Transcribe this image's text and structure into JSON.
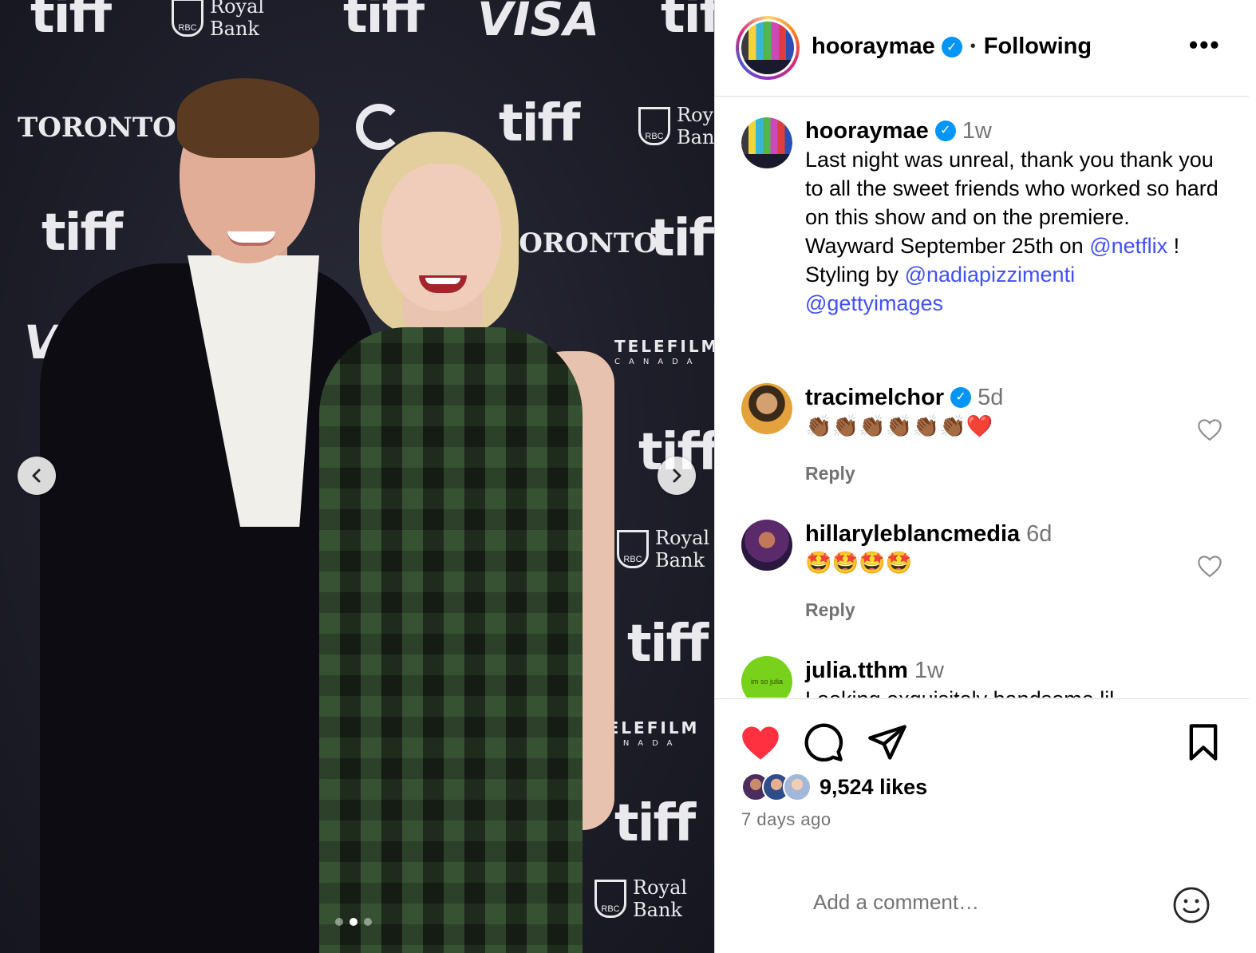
{
  "photo": {
    "backdrop_logos": {
      "tiff": "tiff",
      "visa": "VISA",
      "toronto": "TORONTO",
      "royal": "Royal",
      "bank": "Bank",
      "rbc": "RBC",
      "telefilm": "TELEFILM",
      "canada": "CANADA"
    },
    "carousel": {
      "count": 3,
      "active_index": 1
    },
    "icons": {
      "prev": "chevron-left-icon",
      "next": "chevron-right-icon"
    }
  },
  "header": {
    "username": "hooraymae",
    "separator": "•",
    "follow_status": "Following",
    "more": "•••"
  },
  "caption": {
    "username": "hooraymae",
    "time": "1w",
    "line1": "Last night was unreal, thank you thank you to all the sweet friends who worked so hard on this show and on the premiere.",
    "line2_text": "Wayward September 25th on ",
    "line2_mention": "@netflix",
    "line2_end": " !",
    "line3_text": "Styling by ",
    "line3_mention": "@nadiapizzimenti",
    "line4_mention": "@gettyimages"
  },
  "comments": [
    {
      "username": "tracimelchor",
      "verified": true,
      "time": "5d",
      "text": "👏🏾👏🏾👏🏾👏🏾👏🏾👏🏾❤️",
      "reply": "Reply"
    },
    {
      "username": "hillaryleblancmedia",
      "verified": false,
      "time": "6d",
      "text": "🤩🤩🤩🤩",
      "reply": "Reply"
    },
    {
      "username": "julia.tthm",
      "verified": false,
      "time": "1w",
      "text": "Looking exquisitely handsome lil",
      "avatar_text": "im so julia"
    }
  ],
  "actions": {
    "likes": "9,524 likes",
    "date": "7 days ago",
    "comment_placeholder": "Add a comment…",
    "liked": true
  },
  "colors": {
    "link": "#4150f7",
    "verified": "#0095f6",
    "like_red": "#ff3040",
    "muted": "#737373",
    "border": "#dbdbdb"
  }
}
